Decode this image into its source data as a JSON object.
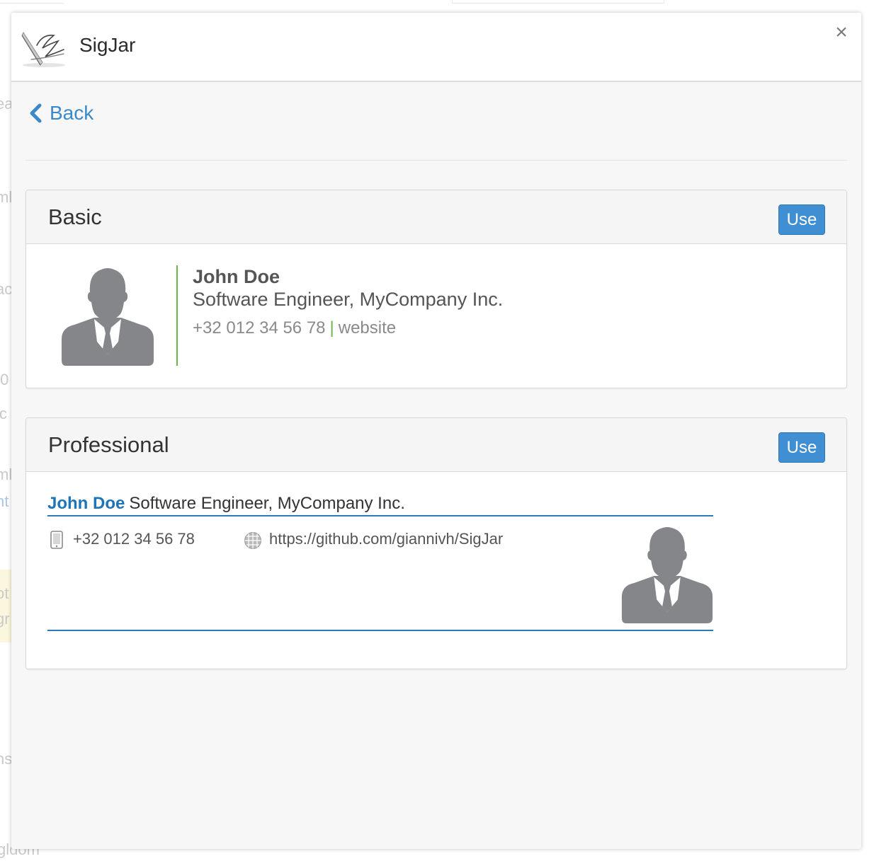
{
  "app": {
    "title": "SigJar",
    "close_label": "×"
  },
  "nav": {
    "back_label": "Back"
  },
  "background": {
    "fragments": [
      "ea",
      "ml",
      "ac",
      ".0",
      "ic",
      "ml",
      "nt",
      "ot",
      "gr",
      "ns"
    ],
    "bottom_fragment": "gldom"
  },
  "templates": [
    {
      "name": "Basic",
      "use_label": "Use",
      "signature": {
        "name": "John Doe",
        "title": "Software Engineer, MyCompany Inc.",
        "phone": "+32 012 34 56 78",
        "separator": "|",
        "website_label": "website"
      }
    },
    {
      "name": "Professional",
      "use_label": "Use",
      "signature": {
        "name": "John Doe",
        "title": "Software Engineer, MyCompany Inc.",
        "phone": "+32 012 34 56 78",
        "url": "https://github.com/giannivh/SigJar"
      }
    }
  ],
  "icons": {
    "logo": "signature-pen-logo",
    "back": "chevron-left-icon",
    "close": "close-icon",
    "phone": "mobile-phone-icon",
    "web": "globe-icon",
    "avatar": "person-silhouette-icon"
  },
  "colors": {
    "accent": "#3f8fd2",
    "link": "#3b89c9",
    "pro_blue": "#1d74b8",
    "basic_green": "#6ab64a",
    "avatar_gray": "#85868a"
  }
}
